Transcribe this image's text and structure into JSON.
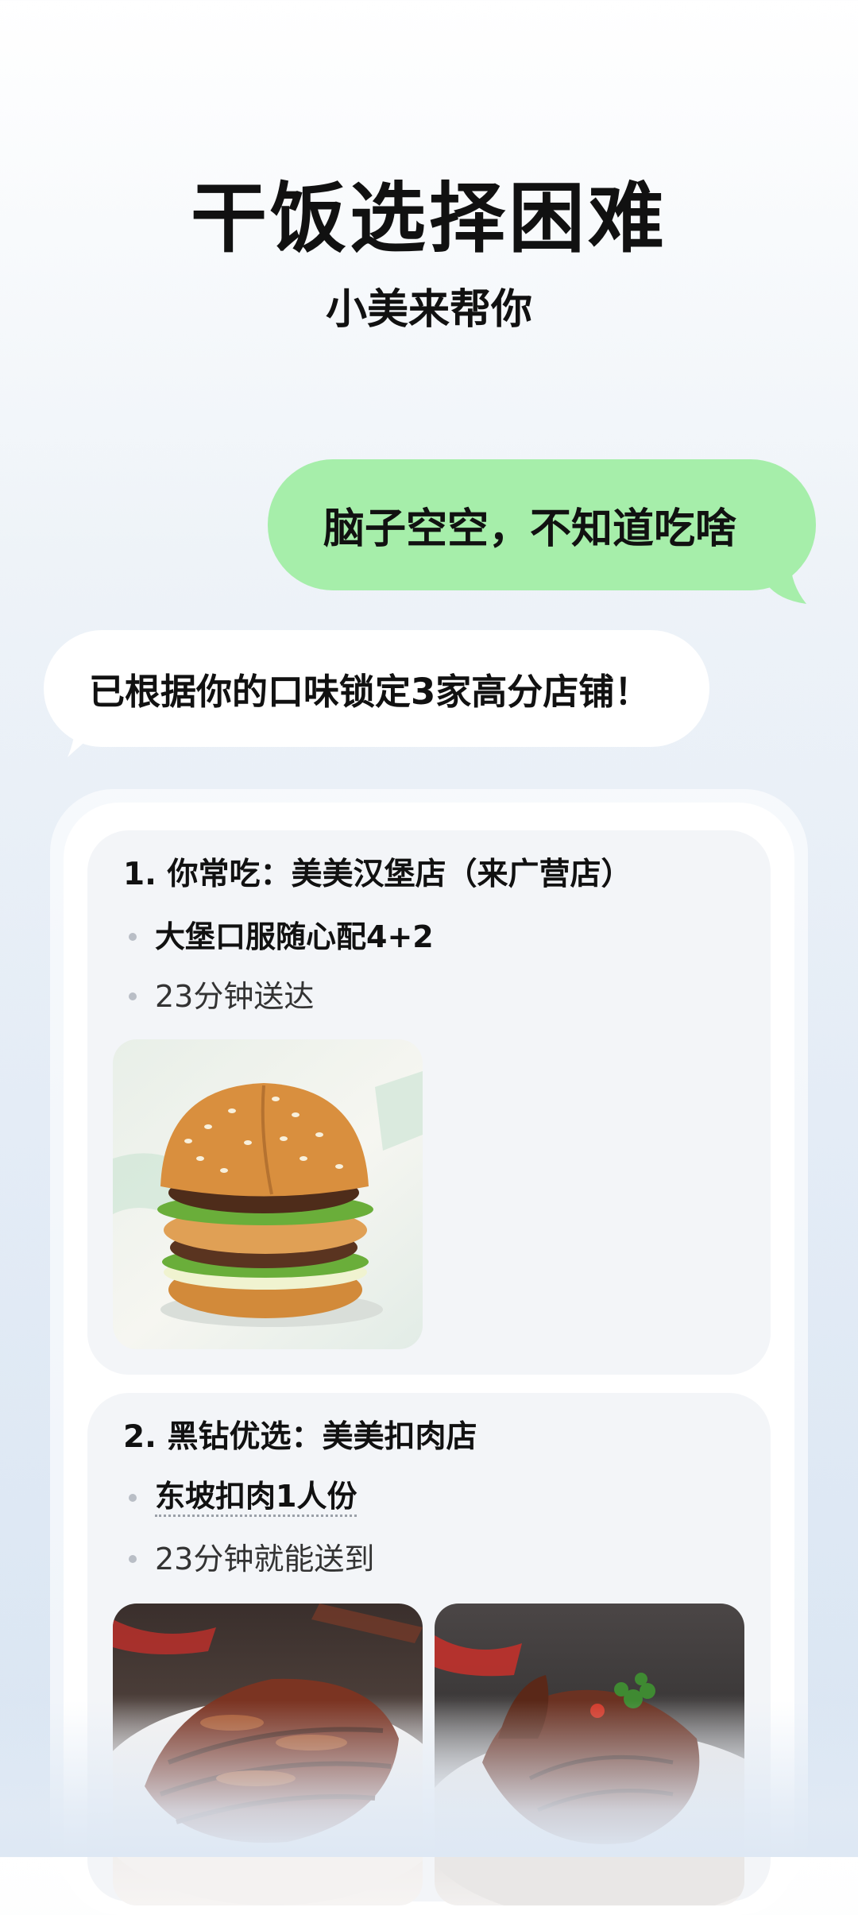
{
  "hero": {
    "title": "干饭选择困难",
    "subtitle": "小美来帮你"
  },
  "chat": {
    "user_message": "脑子空空，不知道吃啥",
    "bot_message": "已根据你的口味锁定3家高分店铺！",
    "colors": {
      "user_bubble": "#a6eeaa",
      "bot_bubble": "#ffffff"
    }
  },
  "recommendations": [
    {
      "title": "1. 你常吃：美美汉堡店（来广营店）",
      "items": [
        "大堡口服随心配4+2",
        "23分钟送达"
      ],
      "photo_icons": [
        "burger-photo"
      ]
    },
    {
      "title": "2. 黑钻优选：美美扣肉店",
      "items": [
        "东坡扣肉1人份",
        "23分钟就能送到"
      ],
      "photo_icons": [
        "braised-pork-photo",
        "braised-duck-photo"
      ]
    }
  ]
}
